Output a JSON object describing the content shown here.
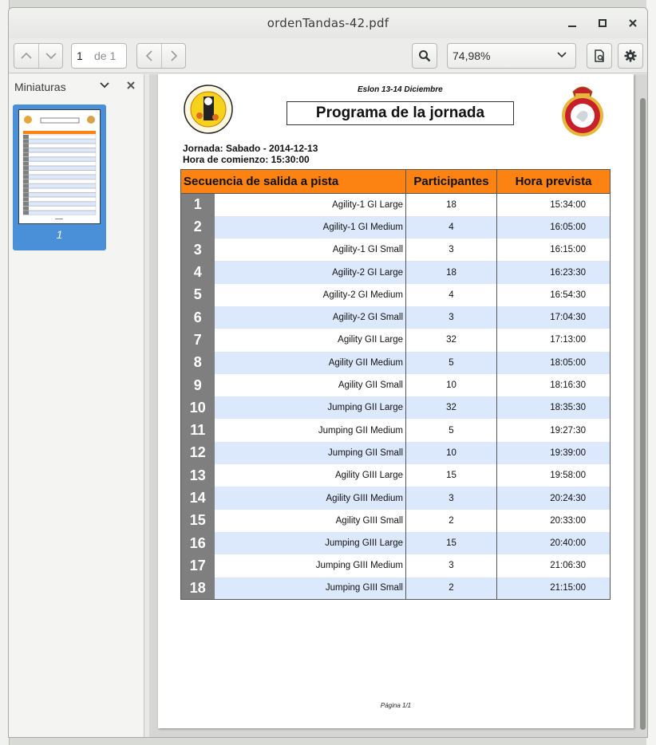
{
  "window": {
    "title": "ordenTandas-42.pdf",
    "controls": [
      "minimize",
      "maximize",
      "close"
    ]
  },
  "toolbar": {
    "page_current": "1",
    "page_of": "de 1",
    "zoom": "74,98%",
    "icons": [
      "chevron-up-icon",
      "chevron-down-icon",
      "chevron-left-icon",
      "chevron-right-icon",
      "search-icon",
      "document-icon",
      "gear-icon"
    ]
  },
  "sidebar": {
    "title": "Miniaturas",
    "thumbnail_label": "1"
  },
  "document": {
    "event": "Eslon 13-14 Diciembre",
    "title": "Programa de la jornada",
    "jornada": "Jornada: Sabado - 2014-12-13",
    "hora": "Hora de comienzo: 15:30:00",
    "columns": [
      "Secuencia de salida a pista",
      "Participantes",
      "Hora prevista"
    ],
    "rows": [
      {
        "n": "1",
        "name": "Agility-1 GI Large",
        "parts": "18",
        "time": "15:34:00"
      },
      {
        "n": "2",
        "name": "Agility-1 GI Medium",
        "parts": "4",
        "time": "16:05:00"
      },
      {
        "n": "3",
        "name": "Agility-1 GI Small",
        "parts": "3",
        "time": "16:15:00"
      },
      {
        "n": "4",
        "name": "Agility-2 GI Large",
        "parts": "18",
        "time": "16:23:30"
      },
      {
        "n": "5",
        "name": "Agility-2 GI Medium",
        "parts": "4",
        "time": "16:54:30"
      },
      {
        "n": "6",
        "name": "Agility-2 GI Small",
        "parts": "3",
        "time": "17:04:30"
      },
      {
        "n": "7",
        "name": "Agility GII Large",
        "parts": "32",
        "time": "17:13:00"
      },
      {
        "n": "8",
        "name": "Agility GII Medium",
        "parts": "5",
        "time": "18:05:00"
      },
      {
        "n": "9",
        "name": "Agility GII Small",
        "parts": "10",
        "time": "18:16:30"
      },
      {
        "n": "10",
        "name": "Jumping GII Large",
        "parts": "32",
        "time": "18:35:30"
      },
      {
        "n": "11",
        "name": "Jumping GII Medium",
        "parts": "5",
        "time": "19:27:30"
      },
      {
        "n": "12",
        "name": "Jumping GII Small",
        "parts": "10",
        "time": "19:39:00"
      },
      {
        "n": "13",
        "name": "Agility GIII Large",
        "parts": "15",
        "time": "19:58:00"
      },
      {
        "n": "14",
        "name": "Agility GIII Medium",
        "parts": "3",
        "time": "20:24:30"
      },
      {
        "n": "15",
        "name": "Agility GIII Small",
        "parts": "2",
        "time": "20:33:00"
      },
      {
        "n": "16",
        "name": "Jumping GIII Large",
        "parts": "15",
        "time": "20:40:00"
      },
      {
        "n": "17",
        "name": "Jumping GIII Medium",
        "parts": "3",
        "time": "21:06:30"
      },
      {
        "n": "18",
        "name": "Jumping GIII Small",
        "parts": "2",
        "time": "21:15:00"
      }
    ],
    "footer": "Página 1/1"
  },
  "colors": {
    "header_orange": "#fc8212",
    "row_blue": "#dce8fb",
    "index_gray": "#7f7f7f",
    "selection_blue": "#4a90d9"
  }
}
